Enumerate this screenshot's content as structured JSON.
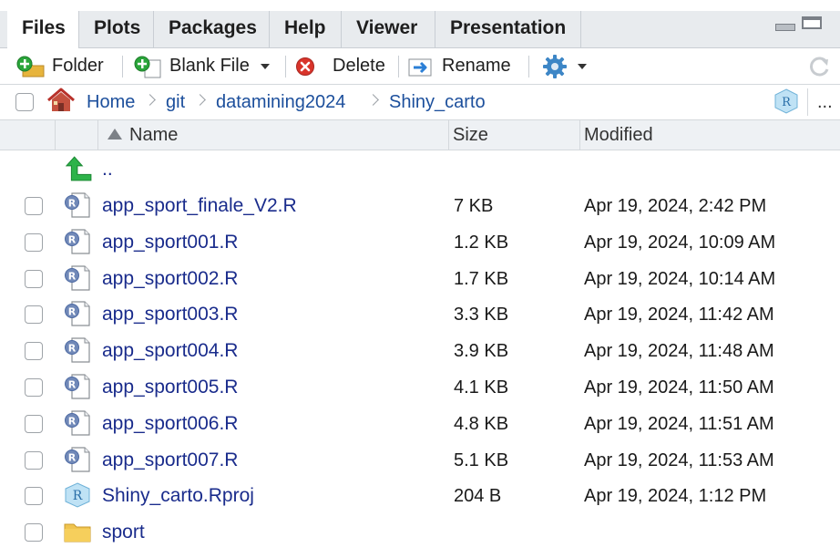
{
  "tabs": [
    {
      "label": "Files",
      "active": true
    },
    {
      "label": "Plots",
      "active": false
    },
    {
      "label": "Packages",
      "active": false
    },
    {
      "label": "Help",
      "active": false
    },
    {
      "label": "Viewer",
      "active": false
    },
    {
      "label": "Presentation",
      "active": false
    }
  ],
  "toolbar": {
    "new_folder_label": "Folder",
    "blank_file_label": "Blank File",
    "delete_label": "Delete",
    "rename_label": "Rename",
    "more_icon": "gear-icon",
    "refresh_icon": "refresh-icon"
  },
  "breadcrumb": {
    "home_icon": "home-icon",
    "items": [
      "Home",
      "git",
      "datamining2024",
      "Shiny_carto"
    ],
    "project_icon": "rproj-icon",
    "overflow_label": "..."
  },
  "columns": {
    "name": "Name",
    "size": "Size",
    "modified": "Modified"
  },
  "parent_dir_label": "..",
  "files": [
    {
      "name": "app_sport_finale_V2.R",
      "size": "7 KB",
      "modified": "Apr 19, 2024, 2:42 PM",
      "type": "r-file"
    },
    {
      "name": "app_sport001.R",
      "size": "1.2 KB",
      "modified": "Apr 19, 2024, 10:09 AM",
      "type": "r-file"
    },
    {
      "name": "app_sport002.R",
      "size": "1.7 KB",
      "modified": "Apr 19, 2024, 10:14 AM",
      "type": "r-file"
    },
    {
      "name": "app_sport003.R",
      "size": "3.3 KB",
      "modified": "Apr 19, 2024, 11:42 AM",
      "type": "r-file"
    },
    {
      "name": "app_sport004.R",
      "size": "3.9 KB",
      "modified": "Apr 19, 2024, 11:48 AM",
      "type": "r-file"
    },
    {
      "name": "app_sport005.R",
      "size": "4.1 KB",
      "modified": "Apr 19, 2024, 11:50 AM",
      "type": "r-file"
    },
    {
      "name": "app_sport006.R",
      "size": "4.8 KB",
      "modified": "Apr 19, 2024, 11:51 AM",
      "type": "r-file"
    },
    {
      "name": "app_sport007.R",
      "size": "5.1 KB",
      "modified": "Apr 19, 2024, 11:53 AM",
      "type": "r-file"
    },
    {
      "name": "Shiny_carto.Rproj",
      "size": "204 B",
      "modified": "Apr 19, 2024, 1:12 PM",
      "type": "rproj-file"
    },
    {
      "name": "sport",
      "size": "",
      "modified": "",
      "type": "folder"
    }
  ],
  "colors": {
    "link": "#1c4f9c",
    "file_name": "#1a2c8c",
    "tab_bar": "#e8ebee",
    "header": "#eef1f4"
  }
}
